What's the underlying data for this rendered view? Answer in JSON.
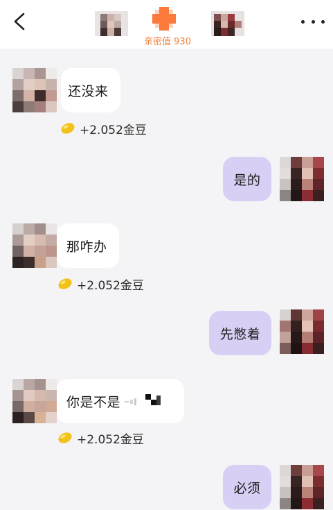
{
  "header": {
    "back_icon": "chevron-left-icon",
    "more_icon": "ellipsis-horizontal-icon",
    "intimacy_label": "亲密值 930",
    "accent_color": "#f0813d",
    "heart_color": "#fb7a3c"
  },
  "messages": [
    {
      "side": "in",
      "text": "还没来",
      "reward": "+2.052金豆"
    },
    {
      "side": "out",
      "text": "是的"
    },
    {
      "side": "in",
      "text": "那咋办",
      "reward": "+2.052金豆"
    },
    {
      "side": "out",
      "text": "先憋着"
    },
    {
      "side": "in",
      "text": "你是不是",
      "reward": "+2.052金豆"
    },
    {
      "side": "out",
      "text": "必须"
    }
  ],
  "colors": {
    "background": "#f4f4f6",
    "incoming_bubble": "#ffffff",
    "outgoing_bubble": "#d8cff4",
    "coin": "#f2c21b"
  }
}
